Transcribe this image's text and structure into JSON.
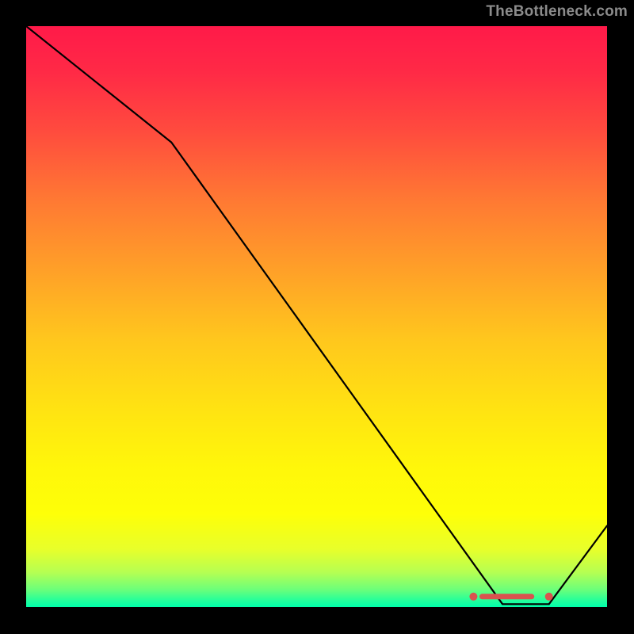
{
  "watermark": "TheBottleneck.com",
  "chart_data": {
    "type": "line",
    "title": "",
    "xlabel": "",
    "ylabel": "",
    "xlim": [
      0,
      100
    ],
    "ylim": [
      0,
      100
    ],
    "grid": false,
    "series": [
      {
        "name": "bottleneck-curve",
        "x": [
          0,
          25,
          82,
          90,
          100
        ],
        "y": [
          100,
          80,
          0.5,
          0.5,
          14
        ],
        "color": "#000000"
      }
    ],
    "markers": {
      "name": "optimal-range",
      "color": "#d9534f",
      "dots_x": [
        77,
        90
      ],
      "dots_y": [
        1.8,
        1.8
      ],
      "segment": {
        "x": [
          78.5,
          87
        ],
        "y": 1.8
      }
    },
    "gradient_stops": [
      {
        "pos": 0.0,
        "color": "#ff1a49"
      },
      {
        "pos": 0.5,
        "color": "#ffc71d"
      },
      {
        "pos": 0.8,
        "color": "#fff70a"
      },
      {
        "pos": 1.0,
        "color": "#00ffab"
      }
    ]
  }
}
